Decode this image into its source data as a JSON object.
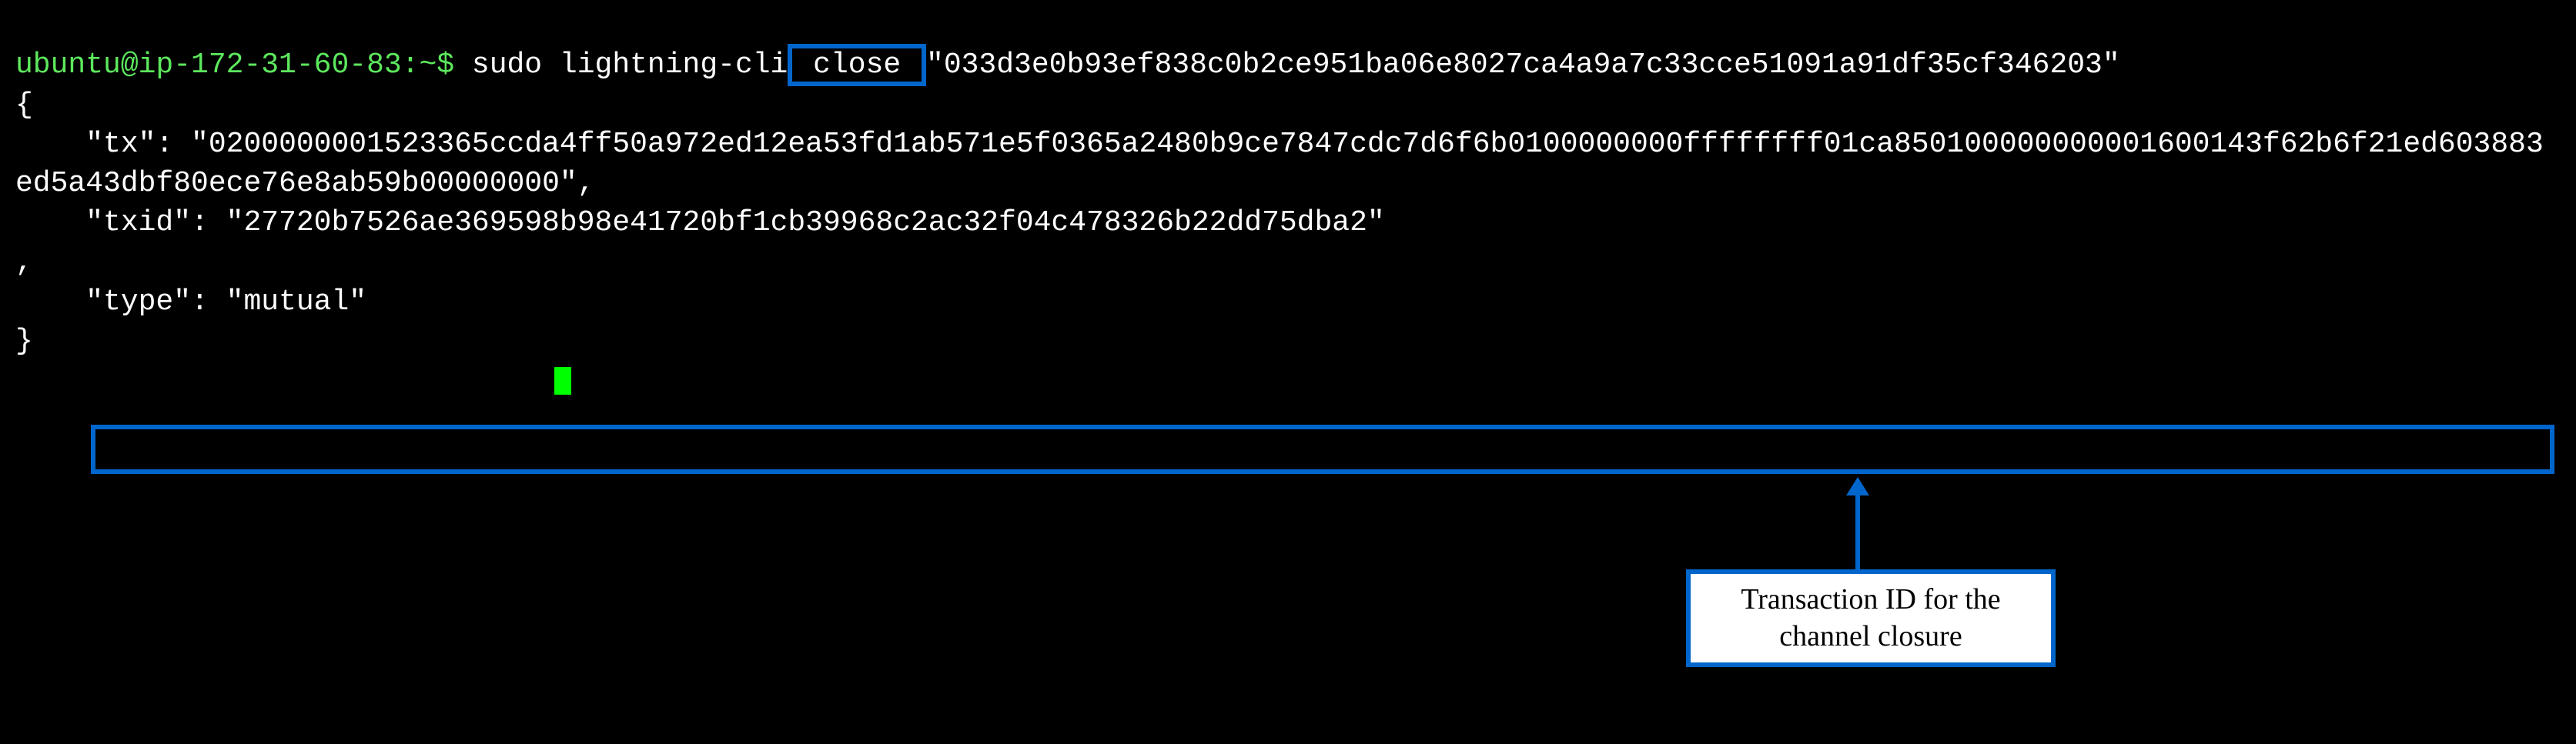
{
  "terminal": {
    "prompt": "ubuntu@ip-172-31-60-83:~$",
    "command_part1": " sudo lightning-cli",
    "command_close": " close ",
    "command_part2": "\"033d3e0b93ef838c0b2ce951ba06e8027ca4a9a7c33cce51091a91df35cf346203\"",
    "open_brace": "{",
    "tx_key": "    \"tx\": ",
    "tx_value": "\"0200000001523365ccda4ff50a972ed12ea53fd1ab571e5f0365a2480b9ce7847cdc7d6f6b0100000000ffffffff01ca850100000000001600143f62b6f21ed603883ed5a43dbf80ece76e8ab59b00000000\",",
    "txid_key": "    \"txid\": ",
    "txid_value": "\"27720b7526ae369598b98e41720bf1cb39968c2ac32f04c478326b22dd75dba2\"",
    "comma_line": ",",
    "type_key": "    \"type\": ",
    "type_value": "\"mutual\"",
    "close_brace": "}"
  },
  "annotation": {
    "callout_line1": "Transaction ID for the",
    "callout_line2": "channel closure"
  }
}
